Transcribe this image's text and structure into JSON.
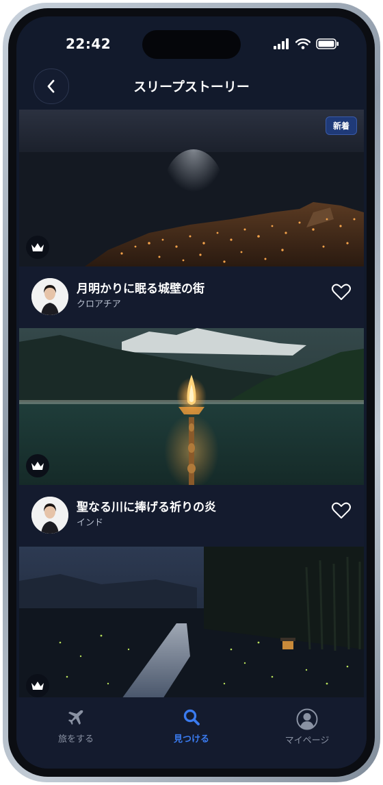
{
  "status": {
    "time": "22:42"
  },
  "nav": {
    "title": "スリープストーリー"
  },
  "stories": [
    {
      "title": "月明かりに眠る城壁の街",
      "location": "クロアチア",
      "badge": "新着"
    },
    {
      "title": "聖なる川に捧げる祈りの炎",
      "location": "インド"
    }
  ],
  "tabs": [
    {
      "label": "旅をする",
      "icon": "airplane-icon"
    },
    {
      "label": "見つける",
      "icon": "search-icon"
    },
    {
      "label": "マイページ",
      "icon": "person-icon"
    }
  ],
  "colors": {
    "background": "#121a2c",
    "active_tab": "#3a7bf0",
    "inactive_tab": "#8a92a3",
    "badge": "#1f3a78"
  }
}
